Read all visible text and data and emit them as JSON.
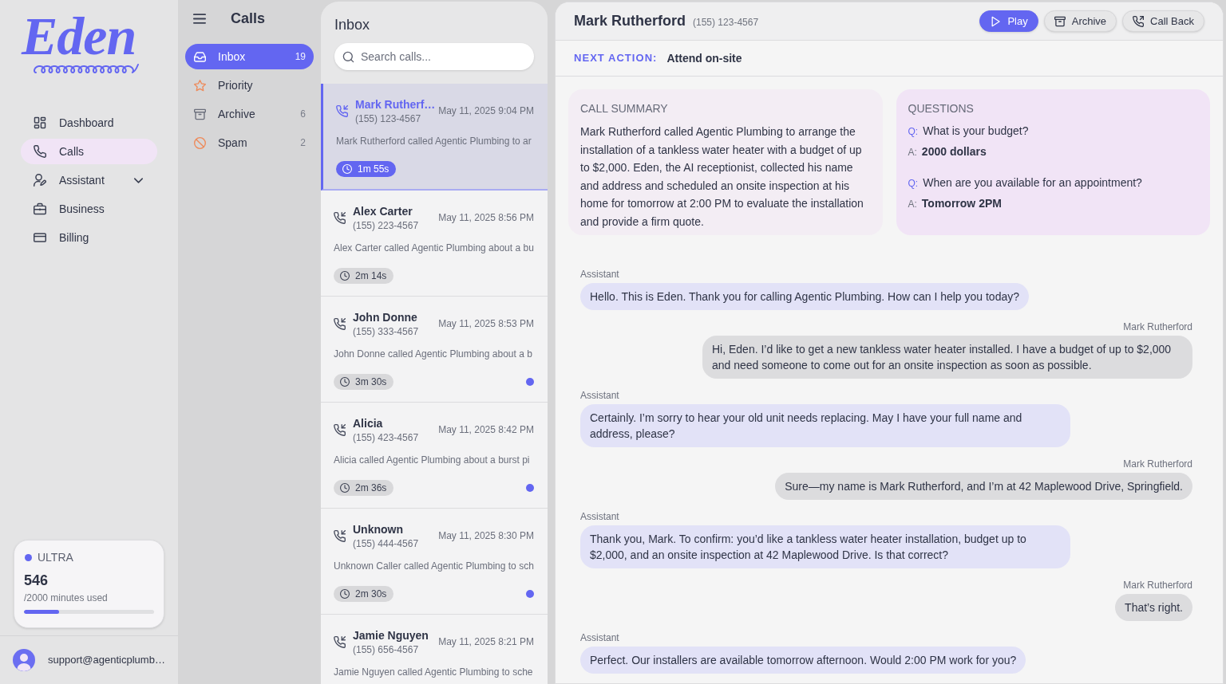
{
  "sidebar": {
    "logo": "Eden",
    "nav": [
      {
        "label": "Dashboard",
        "selected": false
      },
      {
        "label": "Calls",
        "selected": true
      },
      {
        "label": "Assistant",
        "selected": false,
        "expanded": false
      },
      {
        "label": "Business",
        "selected": false
      },
      {
        "label": "Billing",
        "selected": false
      }
    ],
    "plan": {
      "tier": "ULTRA",
      "minutes": "546",
      "caption": "/2000 minutes used",
      "level": 0.27
    },
    "user": {
      "email": "support@agenticplumb…"
    }
  },
  "folders_panel": {
    "title": "Calls",
    "folders": [
      {
        "label": "Inbox",
        "count": "19",
        "selected": true
      },
      {
        "label": "Priority",
        "selected": false
      },
      {
        "label": "Archive",
        "count": "6",
        "selected": false
      },
      {
        "label": "Spam",
        "count": "2",
        "selected": false
      }
    ]
  },
  "inbox": {
    "title": "Inbox",
    "search": {
      "placeholder": "Search calls..."
    },
    "calls": [
      {
        "name": "Mark Rutherf…",
        "phone": "(155) 123-4567",
        "date": "May 11, 2025 9:04 PM",
        "preview": "Mark Rutherford called Agentic Plumbing to ar",
        "duration": "1m 55s",
        "selected": true,
        "unread": false
      },
      {
        "name": "Alex Carter",
        "phone": "(155) 223-4567",
        "date": "May 11, 2025 8:56 PM",
        "preview": "Alex Carter called Agentic Plumbing about a bu",
        "duration": "2m 14s",
        "selected": false,
        "unread": false
      },
      {
        "name": "John Donne",
        "phone": "(155) 333-4567",
        "date": "May 11, 2025 8:53 PM",
        "preview": "John Donne called Agentic Plumbing about a b",
        "duration": "3m 30s",
        "selected": false,
        "unread": true
      },
      {
        "name": "Alicia",
        "phone": "(155) 423-4567",
        "date": "May 11, 2025 8:42 PM",
        "preview": "Alicia called Agentic Plumbing about a burst pi",
        "duration": "2m 36s",
        "selected": false,
        "unread": true
      },
      {
        "name": "Unknown",
        "phone": "(155) 444-4567",
        "date": "May 11, 2025 8:30 PM",
        "preview": "Unknown Caller called Agentic Plumbing to sch",
        "duration": "2m 30s",
        "selected": false,
        "unread": true
      },
      {
        "name": "Jamie Nguyen",
        "phone": "(155) 656-4567",
        "date": "May 11, 2025 8:21 PM",
        "preview": "Jamie Nguyen called Agentic Plumbing to sche",
        "selected": false
      }
    ]
  },
  "call_detail": {
    "caller": "Mark Rutherford",
    "phone": "(155) 123-4567",
    "actions": [
      {
        "label": "Play",
        "kind": "primary"
      },
      {
        "label": "Archive",
        "kind": "secondary"
      },
      {
        "label": "Call Back",
        "kind": "secondary"
      }
    ],
    "next_action": {
      "label": "NEXT ACTION:",
      "value": "Attend on-site"
    },
    "summary": {
      "title": "CALL SUMMARY",
      "text": "Mark Rutherford called Agentic Plumbing to arrange the installation of a tankless water heater with a budget of up to $2,000. Eden, the AI receptionist, collected his name and address and scheduled an onsite inspection at his home for tomorrow at 2:00 PM to evaluate the installation and provide a firm quote."
    },
    "questions": {
      "title": "QUESTIONS",
      "items": [
        {
          "q": "Q:",
          "question": "What is your budget?",
          "a": "A:",
          "answer": "2000 dollars"
        },
        {
          "q": "Q:",
          "question": "When are you available for an appointment?",
          "a": "A:",
          "answer": "Tomorrow 2PM"
        }
      ]
    },
    "transcript": [
      {
        "speaker": "Assistant",
        "kind": "assistant",
        "text": "Hello. This is Eden. Thank you for calling Agentic Plumbing. How can I help you today?"
      },
      {
        "speaker": "Mark Rutherford",
        "kind": "caller",
        "text": "Hi, Eden. I’d like to get a new tankless water heater installed. I have a budget of up to $2,000 and need someone to come out for an onsite inspection as soon as possible."
      },
      {
        "speaker": "Assistant",
        "kind": "assistant",
        "text": "Certainly. I’m sorry to hear your old unit needs replacing. May I have your full name and address, please?"
      },
      {
        "speaker": "Mark Rutherford",
        "kind": "caller",
        "text": "Sure—my name is Mark Rutherford, and I’m at 42 Maplewood Drive, Springfield."
      },
      {
        "speaker": "Assistant",
        "kind": "assistant",
        "text": "Thank you, Mark. To confirm: you’d like a tankless water heater installation, budget up to $2,000, and an onsite inspection at 42 Maplewood Drive. Is that correct?"
      },
      {
        "speaker": "Mark Rutherford",
        "kind": "caller",
        "text": "That’s right."
      },
      {
        "speaker": "Assistant",
        "kind": "assistant",
        "text": "Perfect. Our installers are available tomorrow afternoon. Would 2:00 PM work for you?"
      }
    ]
  }
}
